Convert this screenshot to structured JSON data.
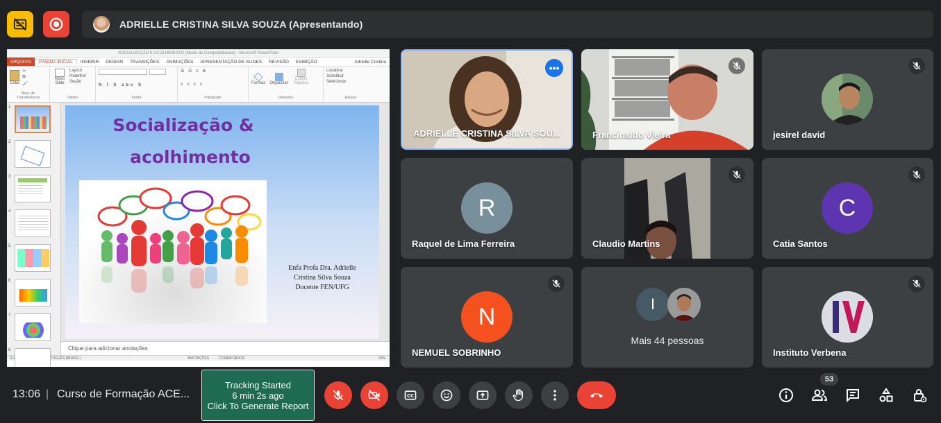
{
  "topbar": {
    "presenter_label": "ADRIELLE CRISTINA SILVA SOUZA (Apresentando)",
    "colors": {
      "caption_off_btn": "#fbbc04",
      "record_btn": "#ea4335"
    }
  },
  "screen_share": {
    "window_title": "SOCIALIZAÇÃO E ACOLHIMENTO (Modo de Compatibilidade) - Microsoft PowerPoint",
    "tabs": [
      "ARQUIVO",
      "PÁGINA INICIAL",
      "INSERIR",
      "DESIGN",
      "TRANSIÇÕES",
      "ANIMAÇÕES",
      "APRESENTAÇÃO DE SLIDES",
      "REVISÃO",
      "EXIBIÇÃO"
    ],
    "user": "Adrielle Cristina",
    "ribbon": {
      "clipboard": {
        "paste": "Colar",
        "label": "Área de Transferência"
      },
      "slides": {
        "new_slide": "Novo Slide",
        "layout": "Layout",
        "reset": "Redefinir",
        "section": "Seção",
        "label": "Slides"
      },
      "font": {
        "label": "Fonte"
      },
      "paragraph": {
        "label": "Parágrafo"
      },
      "drawing": {
        "shapes": "Formas",
        "arrange": "Organizar",
        "quick_styles": "Estilos Rápidos",
        "label": "Desenho"
      },
      "editing": {
        "find": "Localizar",
        "replace": "Substituir",
        "select": "Selecionar",
        "label": "Edição"
      }
    },
    "thumb_numbers": [
      "1",
      "2",
      "3",
      "4",
      "5",
      "6",
      "7",
      "8"
    ],
    "slide": {
      "title_line1": "Socialização &",
      "title_line2": "acolhimento",
      "credit_line1": "Enfa Profa Dra. Adrielle",
      "credit_line2": "Cristina Silva Souza",
      "credit_line3": "Docente FEN/UFG"
    },
    "notes_placeholder": "Clique para adicionar anotações",
    "status": {
      "slide_of": "SLIDE 1 DE 23",
      "language": "PORTUGUÊS (BRASIL)",
      "notes": "ANOTAÇÕES",
      "comments": "COMENTÁRIOS",
      "zoom": "53%"
    }
  },
  "participants": [
    {
      "name": "ADRIELLE CRISTINA SILVA SOU...",
      "type": "video",
      "speaking": true
    },
    {
      "name": "Francinaldo Vieira",
      "type": "video",
      "muted": true
    },
    {
      "name": "jesirel david",
      "type": "photo",
      "muted": true
    },
    {
      "name": "Raquel de Lima Ferreira",
      "type": "initial",
      "initial": "R",
      "color": "#78909c"
    },
    {
      "name": "Claudio Martins",
      "type": "video",
      "muted": true
    },
    {
      "name": "Catia Santos",
      "type": "initial",
      "initial": "C",
      "color": "#5e35b1",
      "muted": true
    },
    {
      "name": "NEMUEL SOBRINHO",
      "type": "initial",
      "initial": "N",
      "color": "#f4511e",
      "muted": true
    },
    {
      "name": "Mais 44 pessoas",
      "type": "more",
      "initial": "I",
      "color": "#455a64"
    },
    {
      "name": "Instituto Verbena",
      "type": "logo",
      "muted": true
    }
  ],
  "bottombar": {
    "time": "13:06",
    "separator": "|",
    "meeting": "Curso de Formação ACE...",
    "tracking_line1": "Tracking Started",
    "tracking_line2": "6 min 2s ago",
    "tracking_line3": "Click To Generate Report",
    "participant_count": "53",
    "icons": [
      "mic-off-icon",
      "camera-off-icon",
      "captions-icon",
      "emoji-icon",
      "present-icon",
      "raise-hand-icon",
      "more-options-icon",
      "end-call-icon",
      "info-icon",
      "people-icon",
      "chat-icon",
      "activities-icon",
      "host-controls-icon"
    ]
  }
}
